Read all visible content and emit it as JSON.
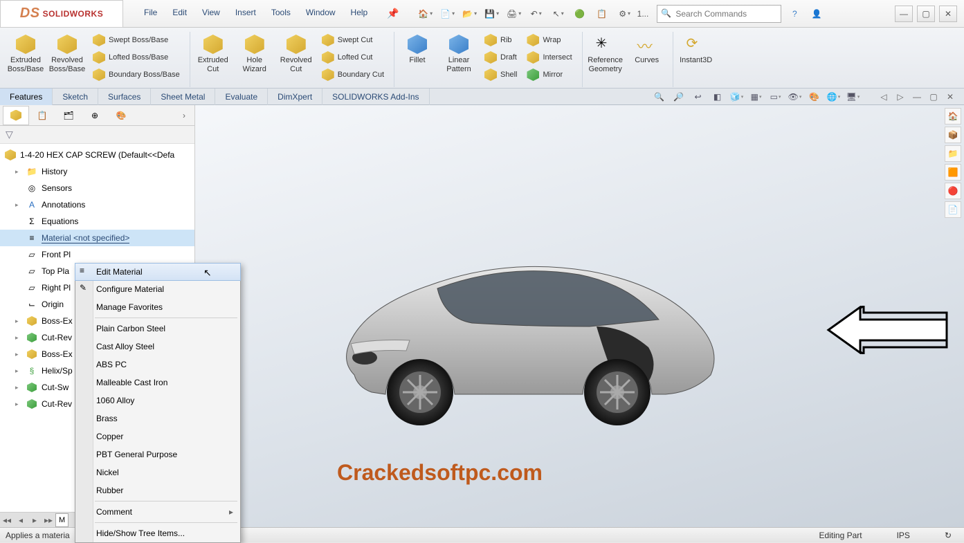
{
  "app": {
    "logo_text": "SOLIDWORKS",
    "search_placeholder": "Search Commands"
  },
  "menu": [
    "File",
    "Edit",
    "View",
    "Insert",
    "Tools",
    "Window",
    "Help"
  ],
  "qat_overflow": "1...",
  "ribbon": {
    "group1": {
      "big": [
        {
          "label": "Extruded Boss/Base"
        },
        {
          "label": "Revolved Boss/Base"
        }
      ],
      "small": [
        "Swept Boss/Base",
        "Lofted Boss/Base",
        "Boundary Boss/Base"
      ]
    },
    "group2": {
      "big": [
        {
          "label": "Extruded Cut"
        },
        {
          "label": "Hole Wizard"
        },
        {
          "label": "Revolved Cut"
        }
      ],
      "small": [
        "Swept Cut",
        "Lofted Cut",
        "Boundary Cut"
      ]
    },
    "group3": {
      "big": [
        {
          "label": "Fillet"
        },
        {
          "label": "Linear Pattern"
        }
      ],
      "small_col1": [
        "Rib",
        "Draft",
        "Shell"
      ],
      "small_col2": [
        "Wrap",
        "Intersect",
        "Mirror"
      ]
    },
    "group4": {
      "big": [
        {
          "label": "Reference Geometry"
        },
        {
          "label": "Curves"
        }
      ]
    },
    "group5": {
      "big": [
        {
          "label": "Instant3D"
        }
      ]
    }
  },
  "tabs": [
    "Features",
    "Sketch",
    "Surfaces",
    "Sheet Metal",
    "Evaluate",
    "DimXpert",
    "SOLIDWORKS Add-Ins"
  ],
  "tree": {
    "root": "1-4-20 HEX CAP SCREW  (Default<<Defa",
    "nodes": [
      {
        "label": "History",
        "icon": "history"
      },
      {
        "label": "Sensors",
        "icon": "sensors"
      },
      {
        "label": "Annotations",
        "icon": "annotations",
        "exp": true
      },
      {
        "label": "Equations",
        "icon": "equations"
      },
      {
        "label": "Material <not specified>",
        "icon": "material",
        "selected": true
      },
      {
        "label": "Front Pl",
        "icon": "plane"
      },
      {
        "label": "Top Pla",
        "icon": "plane"
      },
      {
        "label": "Right Pl",
        "icon": "plane"
      },
      {
        "label": "Origin",
        "icon": "origin"
      },
      {
        "label": "Boss-Ex",
        "icon": "feature",
        "exp": true
      },
      {
        "label": "Cut-Rev",
        "icon": "cut",
        "exp": true
      },
      {
        "label": "Boss-Ex",
        "icon": "feature",
        "exp": true
      },
      {
        "label": "Helix/Sp",
        "icon": "helix",
        "exp": true
      },
      {
        "label": "Cut-Sw",
        "icon": "cut",
        "exp": true
      },
      {
        "label": "Cut-Rev",
        "icon": "cut",
        "exp": true
      }
    ]
  },
  "context_menu": [
    {
      "label": "Edit Material",
      "icon": true,
      "highlighted": true
    },
    {
      "label": "Configure Material",
      "icon": true
    },
    {
      "label": "Manage Favorites"
    },
    {
      "sep": true
    },
    {
      "label": "Plain Carbon Steel"
    },
    {
      "label": "Cast Alloy Steel"
    },
    {
      "label": "ABS PC"
    },
    {
      "label": "Malleable Cast Iron"
    },
    {
      "label": "1060 Alloy"
    },
    {
      "label": "Brass"
    },
    {
      "label": "Copper"
    },
    {
      "label": "PBT General Purpose"
    },
    {
      "label": "Nickel"
    },
    {
      "label": "Rubber"
    },
    {
      "sep": true
    },
    {
      "label": "Comment",
      "submenu": true
    },
    {
      "sep": true
    },
    {
      "label": "Hide/Show Tree Items..."
    }
  ],
  "bottom_tabs": {
    "active": "M"
  },
  "watermark": "Crackedsoftpc.com",
  "statusbar": {
    "left": "Applies a materia",
    "mode": "Editing Part",
    "units": "IPS"
  }
}
